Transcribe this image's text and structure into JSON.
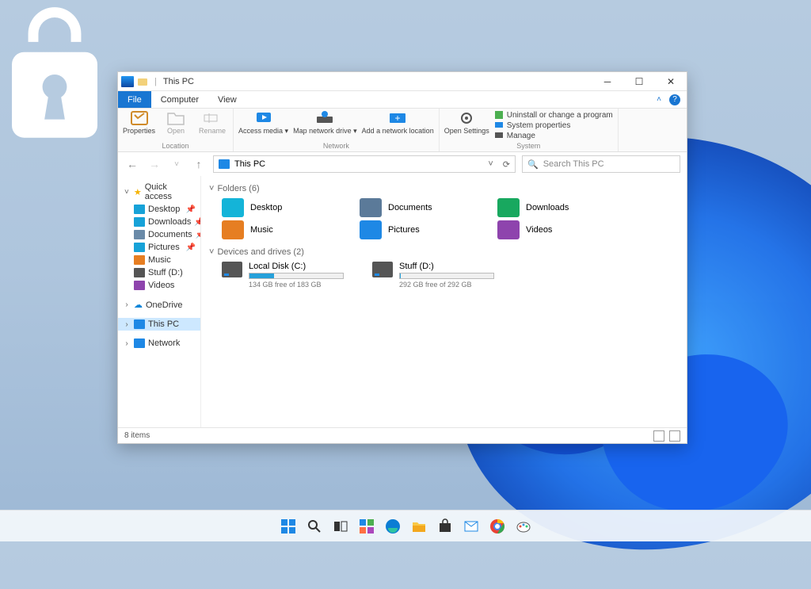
{
  "window": {
    "title": "This PC",
    "tabs": {
      "file": "File",
      "computer": "Computer",
      "view": "View"
    },
    "ribbon": {
      "location": {
        "label": "Location",
        "properties": "Properties",
        "open": "Open",
        "rename": "Rename"
      },
      "network": {
        "label": "Network",
        "access_media": "Access media ▾",
        "map_drive": "Map network drive ▾",
        "add_location": "Add a network location"
      },
      "system": {
        "label": "System",
        "open_settings": "Open Settings",
        "uninstall": "Uninstall or change a program",
        "sys_props": "System properties",
        "manage": "Manage"
      }
    },
    "address": {
      "path": "This PC"
    },
    "search": {
      "placeholder": "Search This PC"
    },
    "sidebar": {
      "quick_access": "Quick access",
      "items": [
        {
          "label": "Desktop",
          "color": "#17a2d8"
        },
        {
          "label": "Downloads",
          "color": "#17a2d8"
        },
        {
          "label": "Documents",
          "color": "#6a8aa8"
        },
        {
          "label": "Pictures",
          "color": "#17a2d8"
        },
        {
          "label": "Music",
          "color": "#e67e22"
        },
        {
          "label": "Stuff (D:)",
          "color": "#555"
        },
        {
          "label": "Videos",
          "color": "#8e44ad"
        }
      ],
      "onedrive": "OneDrive",
      "this_pc": "This PC",
      "network": "Network"
    },
    "content": {
      "folders_header": "Folders (6)",
      "folders": [
        {
          "label": "Desktop",
          "color": "#14b4d8"
        },
        {
          "label": "Documents",
          "color": "#5b7a99"
        },
        {
          "label": "Downloads",
          "color": "#18a85f"
        },
        {
          "label": "Music",
          "color": "#e67e22"
        },
        {
          "label": "Pictures",
          "color": "#1e88e5"
        },
        {
          "label": "Videos",
          "color": "#8e44ad"
        }
      ],
      "drives_header": "Devices and drives (2)",
      "drives": [
        {
          "label": "Local Disk (C:)",
          "free_text": "134 GB free of 183 GB",
          "used_pct": 26
        },
        {
          "label": "Stuff (D:)",
          "free_text": "292 GB free of 292 GB",
          "used_pct": 1
        }
      ]
    },
    "status": {
      "items": "8 items"
    }
  }
}
